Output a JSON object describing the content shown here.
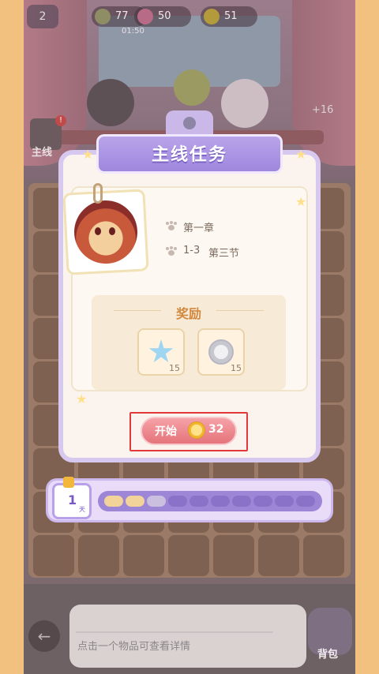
{
  "hud": {
    "level": "2",
    "energy": "77",
    "energy_timer": "01:50",
    "gems": "50",
    "coins": "51",
    "bonus": "+16"
  },
  "scene": {
    "mainline_label": "主线",
    "alert": "!"
  },
  "modal": {
    "title": "主线任务",
    "chapter": "第一章",
    "stage_code": "1-3",
    "section": "第三节",
    "reward_title": "奖励",
    "rewards": [
      {
        "icon": "blue-star-icon",
        "qty": "15"
      },
      {
        "icon": "silver-paw-coin-icon",
        "qty": "15"
      }
    ],
    "start_label": "开始",
    "start_cost": "32"
  },
  "progress": {
    "day_number": "1",
    "day_unit": "天",
    "segments_total": 10,
    "segments_filled": 2,
    "segments_partial": 1
  },
  "bottom": {
    "info_text": "点击一个物品可查看详情",
    "bag_label": "背包",
    "back_icon": "back-arrow-icon"
  },
  "colors": {
    "accent_purple": "#9f87de",
    "start_button": "#e5747b",
    "reward_gold": "#d2893f",
    "highlight_red": "#e23a3a"
  }
}
